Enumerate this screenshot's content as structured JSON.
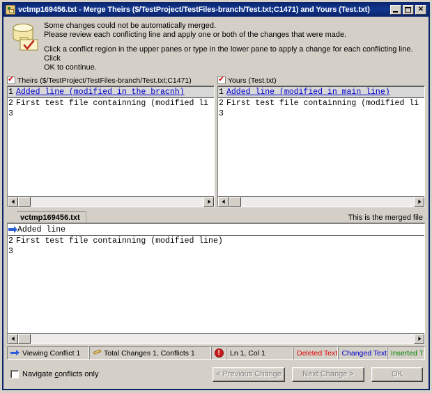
{
  "window": {
    "title": "vctmp169456.txt - Merge Theirs ($/TestProject/TestFiles-branch/Test.txt;C1471) and Yours (Test.txt)",
    "app_icon": "merge-document-icon",
    "buttons": {
      "minimize": "minimize-icon",
      "maximize": "maximize-icon",
      "close": "✕"
    }
  },
  "info": {
    "icon": "database-folder-check-icon",
    "line1": "Some changes could not be automatically merged.",
    "line2": "Please review each conflicting line and apply one or both of the changes that were made.",
    "line3": "Click a conflict region in the upper panes or type in the lower pane to apply a change for each conflicting line. Click",
    "line4": "OK to continue."
  },
  "panes": {
    "theirs": {
      "header": "Theirs ($/TestProject/TestFiles-branch/Test.txt;C1471)",
      "header_icon": "checked-file-icon",
      "lines": [
        {
          "num": "1",
          "text": "Added line (modified in the bracnh)",
          "style": "changed"
        },
        {
          "num": "2",
          "text": "First test file containning (modified li",
          "style": "normal"
        },
        {
          "num": "3",
          "text": "",
          "style": "normal"
        }
      ]
    },
    "yours": {
      "header": "Yours (Test.txt)",
      "header_icon": "checked-file-icon",
      "lines": [
        {
          "num": "1",
          "text": "Added line (modified in main line)",
          "style": "changed"
        },
        {
          "num": "2",
          "text": "First test file containning (modified li",
          "style": "normal"
        },
        {
          "num": "3",
          "text": "",
          "style": "normal"
        }
      ]
    }
  },
  "merged": {
    "tab_label": "vctmp169456.txt",
    "note": "This is the merged file",
    "marker_icon": "conflict-arrow-icon",
    "lines": [
      {
        "num": "",
        "text": "Added line",
        "style": "conflict"
      },
      {
        "num": "2",
        "text": "First test file containning (modified line)",
        "style": "normal"
      },
      {
        "num": "3",
        "text": "",
        "style": "normal"
      }
    ]
  },
  "statusbar": {
    "viewing": "Viewing Conflict 1",
    "viewing_icon": "blue-arrow-icon",
    "changes": "Total Changes 1, Conflicts 1",
    "changes_icon": "pencil-icon",
    "alert_icon": "error-icon",
    "position": "Ln 1, Col 1",
    "legend_deleted": "Deleted Text",
    "legend_changed": "Changed Text",
    "legend_inserted": "Inserted T"
  },
  "bottom": {
    "checkbox_label_pre": "Navigate ",
    "checkbox_label_accel": "c",
    "checkbox_label_post": "onflicts only",
    "checkbox_checked": false,
    "prev_button": "< Previous Change",
    "next_button": "Next Change >",
    "ok_button": "OK"
  },
  "colors": {
    "titlebar": "#0a246a",
    "face": "#d4d0c8",
    "changed": "#0000cc",
    "deleted": "#dd0000",
    "inserted": "#008000"
  }
}
